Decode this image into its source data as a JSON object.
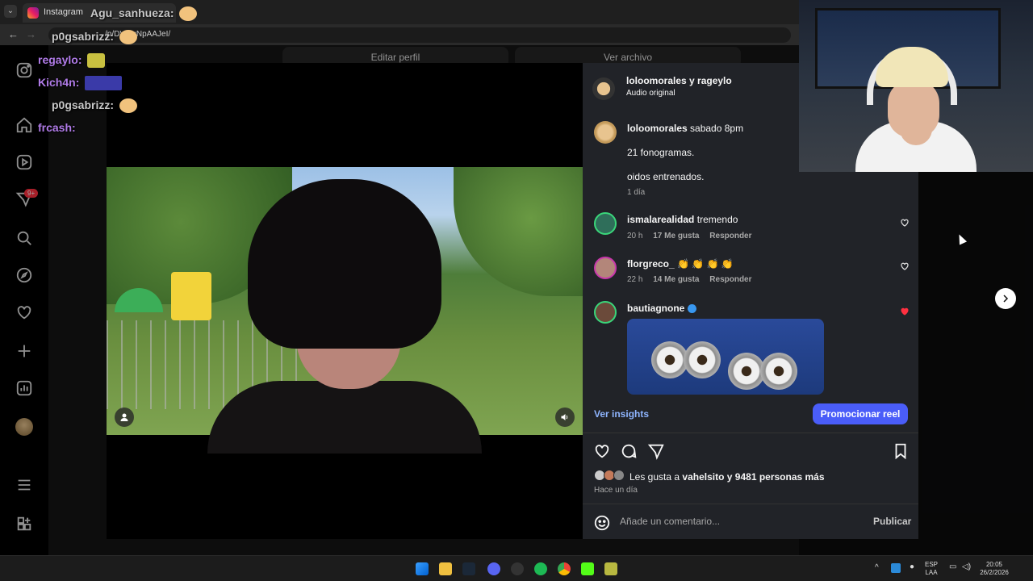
{
  "browser": {
    "tab_title": "Instagram",
    "url": "/p/DVMqNpAAJeI/"
  },
  "profile_buttons": {
    "edit": "Editar perfil",
    "archive": "Ver archivo"
  },
  "sidebar": {
    "notification_badge": "9+"
  },
  "post": {
    "authors": "loloomorales y rageylo",
    "audio": "Audio original",
    "caption_user": "loloomorales",
    "caption_first": "sabado 8pm",
    "caption_line2": "21 fonogramas.",
    "caption_line3": "oidos entrenados.",
    "caption_age": "1 día"
  },
  "comments": [
    {
      "user": "ismalarealidad",
      "text": "tremendo",
      "time": "20 h",
      "likes": "17 Me gusta",
      "reply": "Responder"
    },
    {
      "user": "florgreco_",
      "text": "👏 👏 👏 👏",
      "time": "22 h",
      "likes": "14 Me gusta",
      "reply": "Responder"
    },
    {
      "user": "bautiagnone",
      "text": "",
      "time": "",
      "likes": "",
      "reply": ""
    }
  ],
  "actions": {
    "insights": "Ver insights",
    "promote": "Promocionar reel",
    "likes_prefix": "Les gusta a",
    "likes_user": "vahelsito",
    "likes_joiner": "y",
    "likes_count": "9481 personas más",
    "posted_ago": "Hace un día",
    "comment_placeholder": "Añade un comentario...",
    "publish": "Publicar"
  },
  "chat": [
    {
      "user": "Agu_sanhueza",
      "color": "#c7c7c7"
    },
    {
      "user": "p0gsabrizz",
      "color": "#c7c7c7"
    },
    {
      "user": "regaylo",
      "color": "#b07be8"
    },
    {
      "user": "Kich4n",
      "color": "#b07be8"
    },
    {
      "user": "p0gsabrizz",
      "color": "#c7c7c7"
    },
    {
      "user": "frcash",
      "color": "#b07be8"
    }
  ],
  "taskbar": {
    "lang_top": "ESP",
    "lang_bottom": "LAA",
    "time": "20:05",
    "date": "26/2/2026"
  }
}
